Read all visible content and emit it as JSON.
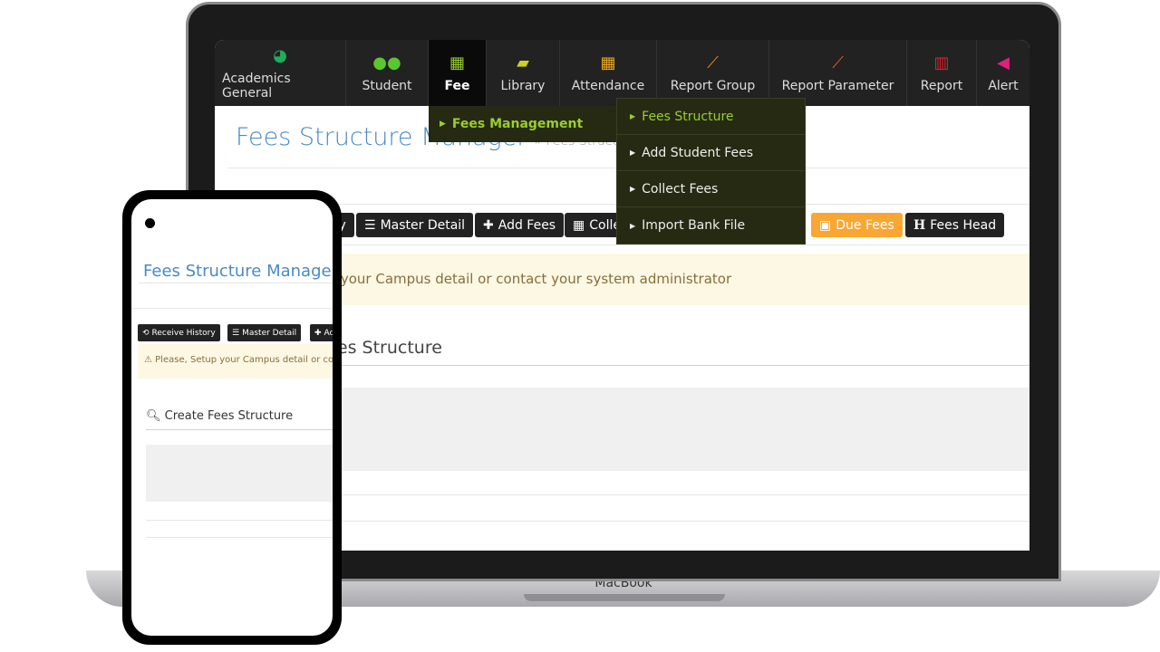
{
  "laptop": {
    "brand": "MacBook"
  },
  "nav": {
    "items": [
      {
        "label": "Academics General",
        "icon": "dashboard-icon",
        "color": "#1fae5b"
      },
      {
        "label": "Student",
        "icon": "users-icon",
        "color": "#5ac630"
      },
      {
        "label": "Fee",
        "icon": "calculator-icon",
        "color": "#9acd32",
        "active": true
      },
      {
        "label": "Library",
        "icon": "book-icon",
        "color": "#c6d22a"
      },
      {
        "label": "Attendance",
        "icon": "calendar-icon",
        "color": "#f0a820"
      },
      {
        "label": "Report Group",
        "icon": "line-chart-icon",
        "color": "#f08a1c"
      },
      {
        "label": "Report Parameter",
        "icon": "line-chart-icon",
        "color": "#f05a1c"
      },
      {
        "label": "Report",
        "icon": "bar-chart-icon",
        "color": "#e0202a"
      },
      {
        "label": "Alert",
        "icon": "megaphone-icon",
        "color": "#e0207a"
      }
    ]
  },
  "dropdown": {
    "label": "Fees Management",
    "submenu": [
      "Fees Structure",
      "Add Student Fees",
      "Collect Fees",
      "Import Bank File"
    ]
  },
  "page": {
    "title": "Fees Structure Manager",
    "breadcrumb": "» Fees Structure",
    "buttons": {
      "receive_history": "Receive History",
      "master_detail": "Master Detail",
      "add_fees": "Add Fees",
      "collect_fees": "Collect Fees",
      "due_fees": "Due Fees",
      "fees_head": "Fees Head"
    },
    "alert": "Please, Setup your Campus detail or contact your system administrator",
    "section": "Create Fees Structure"
  },
  "colors": {
    "accent": "#4a8ac4",
    "due_fees": "#f9a732",
    "menu_highlight": "#9acd32"
  }
}
